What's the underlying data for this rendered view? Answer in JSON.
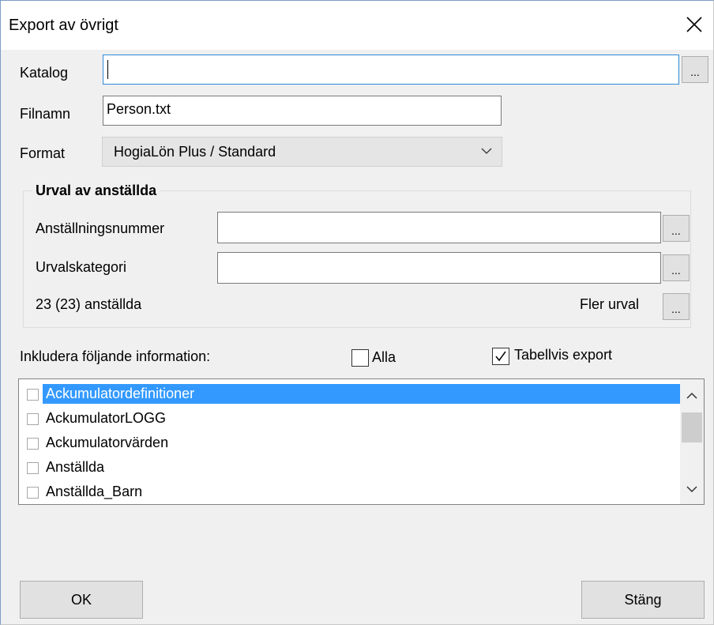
{
  "window": {
    "title": "Export av övrigt"
  },
  "katalog": {
    "label": "Katalog",
    "value": "",
    "browse": "..."
  },
  "filnamn": {
    "label": "Filnamn",
    "value": "Person.txt"
  },
  "format": {
    "label": "Format",
    "value": "HogiaLön Plus / Standard"
  },
  "urval": {
    "title": "Urval av anställda",
    "anst_label": "Anställningsnummer",
    "anst_value": "",
    "kat_label": "Urvalskategori",
    "kat_value": "",
    "count": "23 (23) anställda",
    "fler_label": "Fler urval",
    "browse": "..."
  },
  "include": {
    "label": "Inkludera följande information:",
    "alla_label": "Alla",
    "alla_checked": false,
    "tabell_label": "Tabellvis export",
    "tabell_checked": true
  },
  "list": {
    "items": [
      {
        "label": "Ackumulatordefinitioner",
        "selected": true,
        "checked": false
      },
      {
        "label": "AckumulatorLOGG",
        "selected": false,
        "checked": false
      },
      {
        "label": "Ackumulatorvärden",
        "selected": false,
        "checked": false
      },
      {
        "label": "Anställda",
        "selected": false,
        "checked": false
      },
      {
        "label": "Anställda_Barn",
        "selected": false,
        "checked": false
      }
    ]
  },
  "buttons": {
    "ok": "OK",
    "close": "Stäng"
  }
}
